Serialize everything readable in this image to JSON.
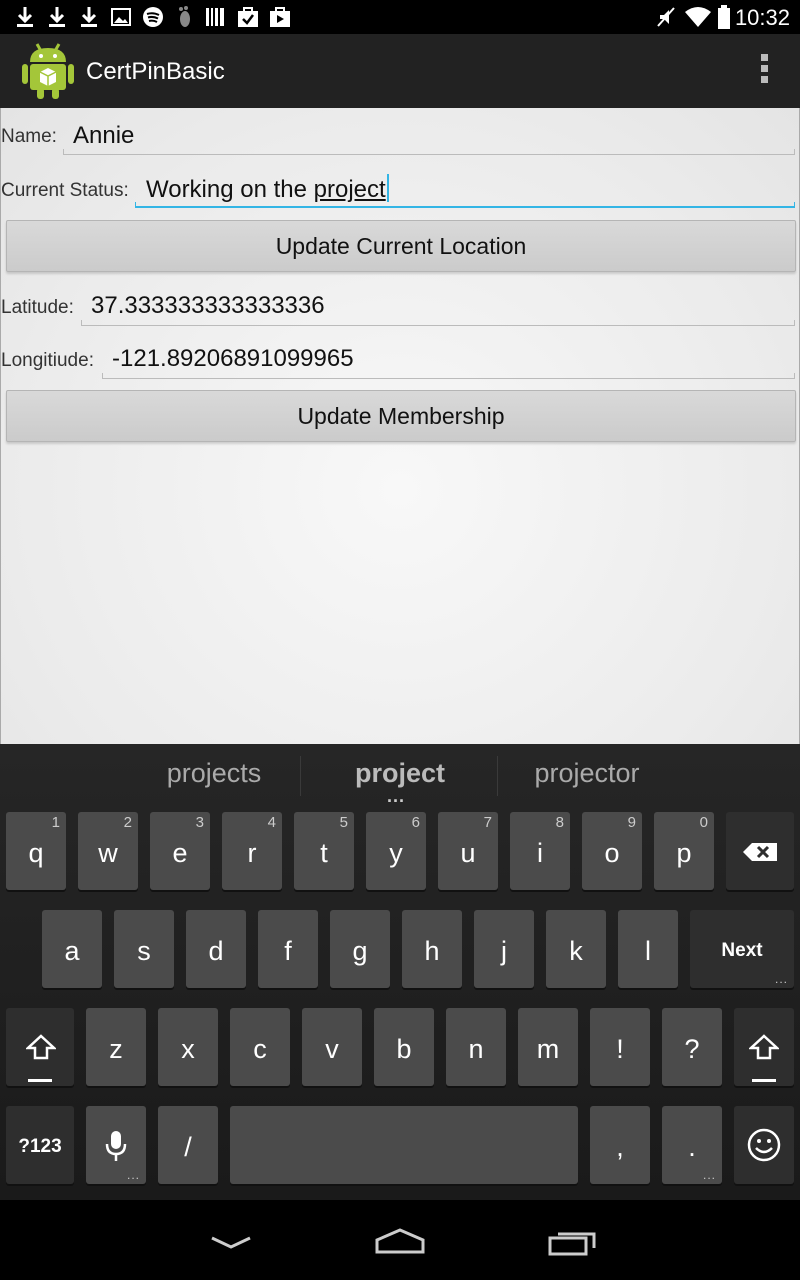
{
  "status_bar": {
    "time": "10:32",
    "left_icons": [
      "download-icon",
      "download-icon",
      "download-icon",
      "image-icon",
      "spotify-icon",
      "foot-icon",
      "barcode-icon",
      "checkbox-bag-icon",
      "shopping-bag-icon"
    ],
    "right_icons": [
      "mute-icon",
      "wifi-icon",
      "battery-icon"
    ]
  },
  "action_bar": {
    "title": "CertPinBasic",
    "logo": "android-icon"
  },
  "form": {
    "name_label": "Name:",
    "name_value": "Annie",
    "status_label": "Current Status:",
    "status_value_prefix": "Working on the ",
    "status_value_word": "project",
    "update_location_button": "Update Current Location",
    "latitude_label": "Latitude:",
    "latitude_value": "37.333333333333336",
    "longitude_label": "Longitiude:",
    "longitude_value": "-121.89206891099965",
    "update_membership_button": "Update Membership"
  },
  "keyboard": {
    "suggestions": [
      "projects",
      "project",
      "projector"
    ],
    "row1": [
      {
        "k": "q",
        "h": "1"
      },
      {
        "k": "w",
        "h": "2"
      },
      {
        "k": "e",
        "h": "3"
      },
      {
        "k": "r",
        "h": "4"
      },
      {
        "k": "t",
        "h": "5"
      },
      {
        "k": "y",
        "h": "6"
      },
      {
        "k": "u",
        "h": "7"
      },
      {
        "k": "i",
        "h": "8"
      },
      {
        "k": "o",
        "h": "9"
      },
      {
        "k": "p",
        "h": "0"
      }
    ],
    "row2": [
      "a",
      "s",
      "d",
      "f",
      "g",
      "h",
      "j",
      "k",
      "l"
    ],
    "next_label": "Next",
    "row3": [
      "z",
      "x",
      "c",
      "v",
      "b",
      "n",
      "m",
      "!",
      "?"
    ],
    "symbols_label": "?123",
    "slash_label": "/",
    "comma_label": ",",
    "period_label": ".",
    "dots_label": "..."
  },
  "nav_bar": {
    "icons": [
      "back-icon",
      "home-icon",
      "recents-icon"
    ]
  }
}
